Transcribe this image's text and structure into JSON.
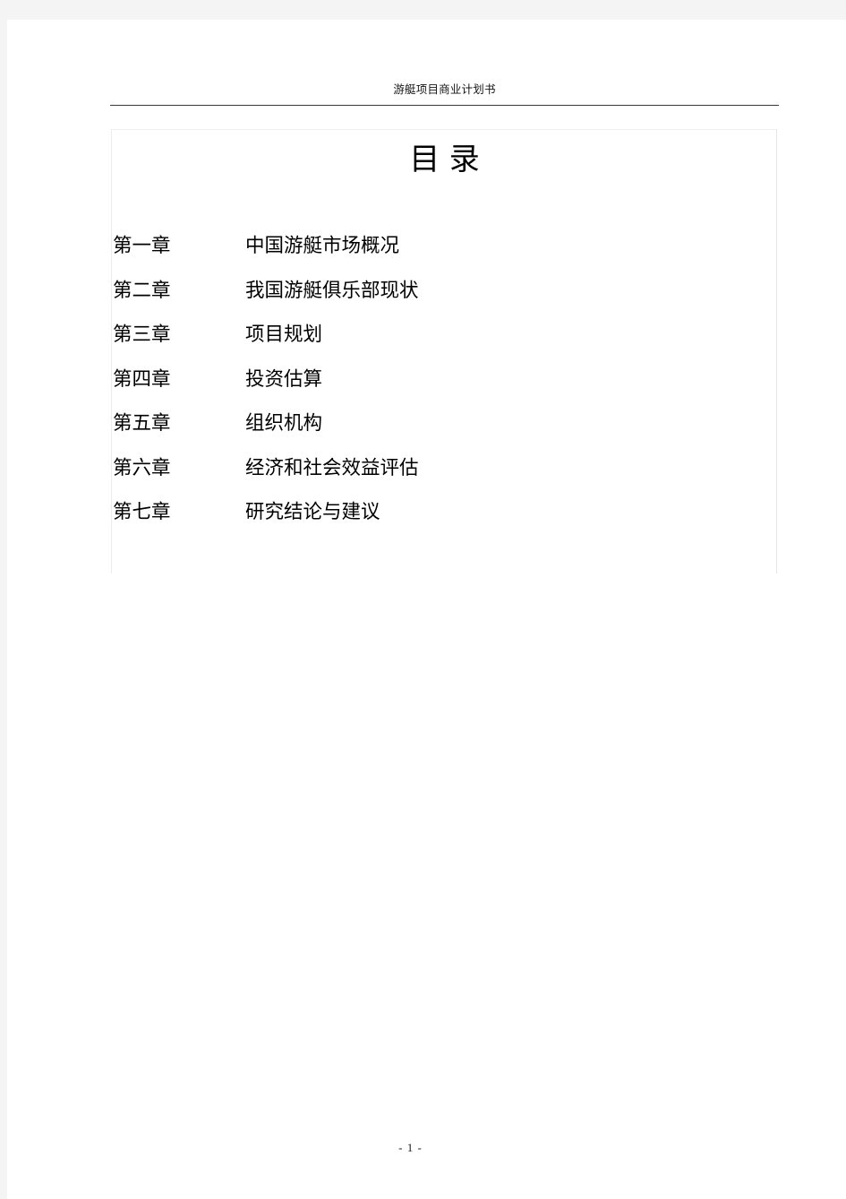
{
  "document": {
    "header_text": "游艇项目商业计划书",
    "title": "目  录",
    "footer_page_number": "- 1 -"
  },
  "toc": {
    "rows": [
      {
        "chapter": "第一章",
        "entry": "中国游艇市场概况"
      },
      {
        "chapter": "第二章",
        "entry": "我国游艇俱乐部现状"
      },
      {
        "chapter": "第三章",
        "entry": "项目规划"
      },
      {
        "chapter": "第四章",
        "entry": "投资估算"
      },
      {
        "chapter": "第五章",
        "entry": "组织机构"
      },
      {
        "chapter": "第六章",
        "entry": "经济和社会效益评估"
      },
      {
        "chapter": "第七章",
        "entry": "研究结论与建议"
      }
    ]
  },
  "colors": {
    "page_background": "#ffffff",
    "canvas_background": "#f4f4f4",
    "header_rule": "#3a3a3a",
    "table_border": "#ececec",
    "text": "#000000"
  }
}
